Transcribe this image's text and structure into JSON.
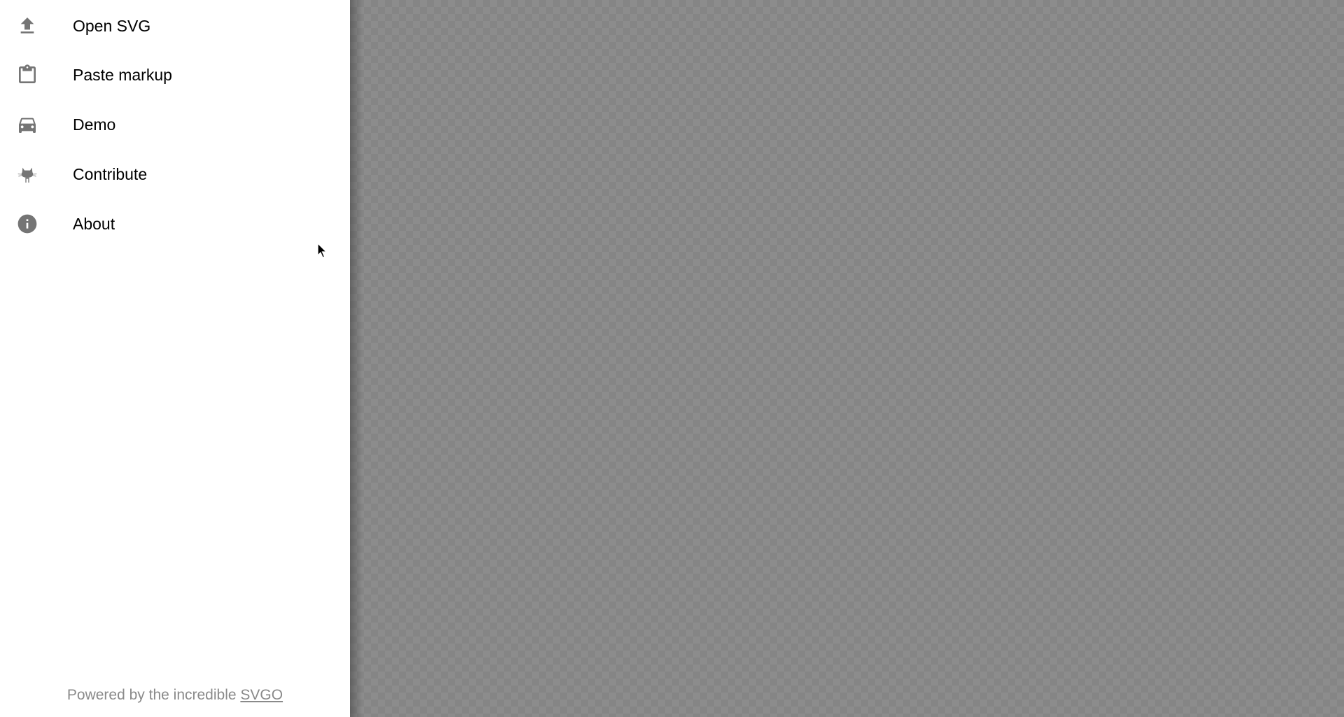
{
  "drawer": {
    "items": [
      {
        "label": "Open SVG",
        "icon": "upload-icon"
      },
      {
        "label": "Paste markup",
        "icon": "clipboard-icon"
      },
      {
        "label": "Demo",
        "icon": "car-icon"
      },
      {
        "label": "Contribute",
        "icon": "github-octocat-icon"
      },
      {
        "label": "About",
        "icon": "info-icon"
      }
    ],
    "footer": {
      "text": "Powered by the incredible ",
      "link": "SVGO"
    }
  },
  "colors": {
    "drawer_bg": "#ffffff",
    "icon": "#757575",
    "canvas_bg": "#8c8c8c",
    "footer_text": "#8a8a8a"
  }
}
